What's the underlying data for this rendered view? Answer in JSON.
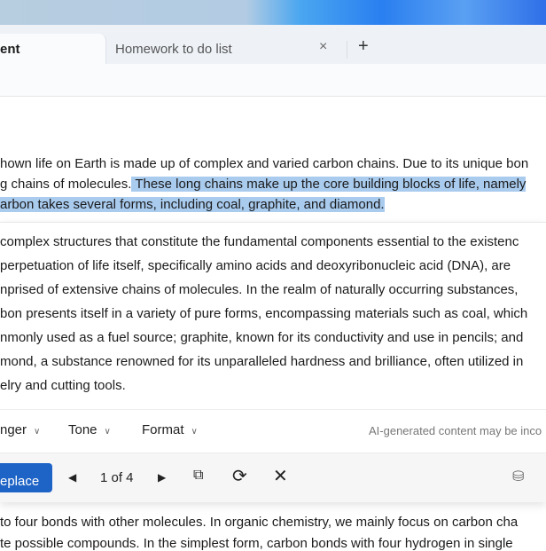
{
  "tabs": [
    {
      "label": "ent",
      "active": true
    },
    {
      "label": "Homework to do list",
      "active": false
    }
  ],
  "tab_close": "×",
  "tab_add": "+",
  "paragraph1": {
    "line1": "hown life on Earth is made up of complex and varied carbon chains. Due to its unique bon",
    "line2_plain": "g chains of molecules.",
    "line2_selected": " These long chains make up the core building blocks of life, namely",
    "line3_selected": "arbon takes several forms, including coal, graphite, and diamond."
  },
  "rewrite_lines": [
    " complex structures that constitute the fundamental components essential to the existenc",
    " perpetuation of life itself, specifically amino acids and deoxyribonucleic acid (DNA), are",
    "nprised of extensive chains of molecules. In the realm of naturally occurring substances,",
    "bon presents itself in a variety of pure forms, encompassing materials such as coal, which",
    "nmonly used as a fuel source; graphite, known for its conductivity and use in pencils; and",
    "mond, a substance renowned for its unparalleled hardness and brilliance, often utilized in",
    "elry and cutting tools."
  ],
  "options": {
    "length": "nger",
    "tone": "Tone",
    "format": "Format",
    "note": "AI-generated content may be inco"
  },
  "actions": {
    "replace": "eplace",
    "counter": "1 of 4",
    "prev_icon": "triangle-left",
    "next_icon": "triangle-right"
  },
  "body_lines": [
    " to four bonds with other molecules. In organic chemistry, we mainly focus on carbon cha",
    "te possible compounds. In the simplest form, carbon bonds with four hydrogen in single"
  ],
  "colors": {
    "accent": "#1e63c6",
    "selection": "#a9cbee"
  }
}
